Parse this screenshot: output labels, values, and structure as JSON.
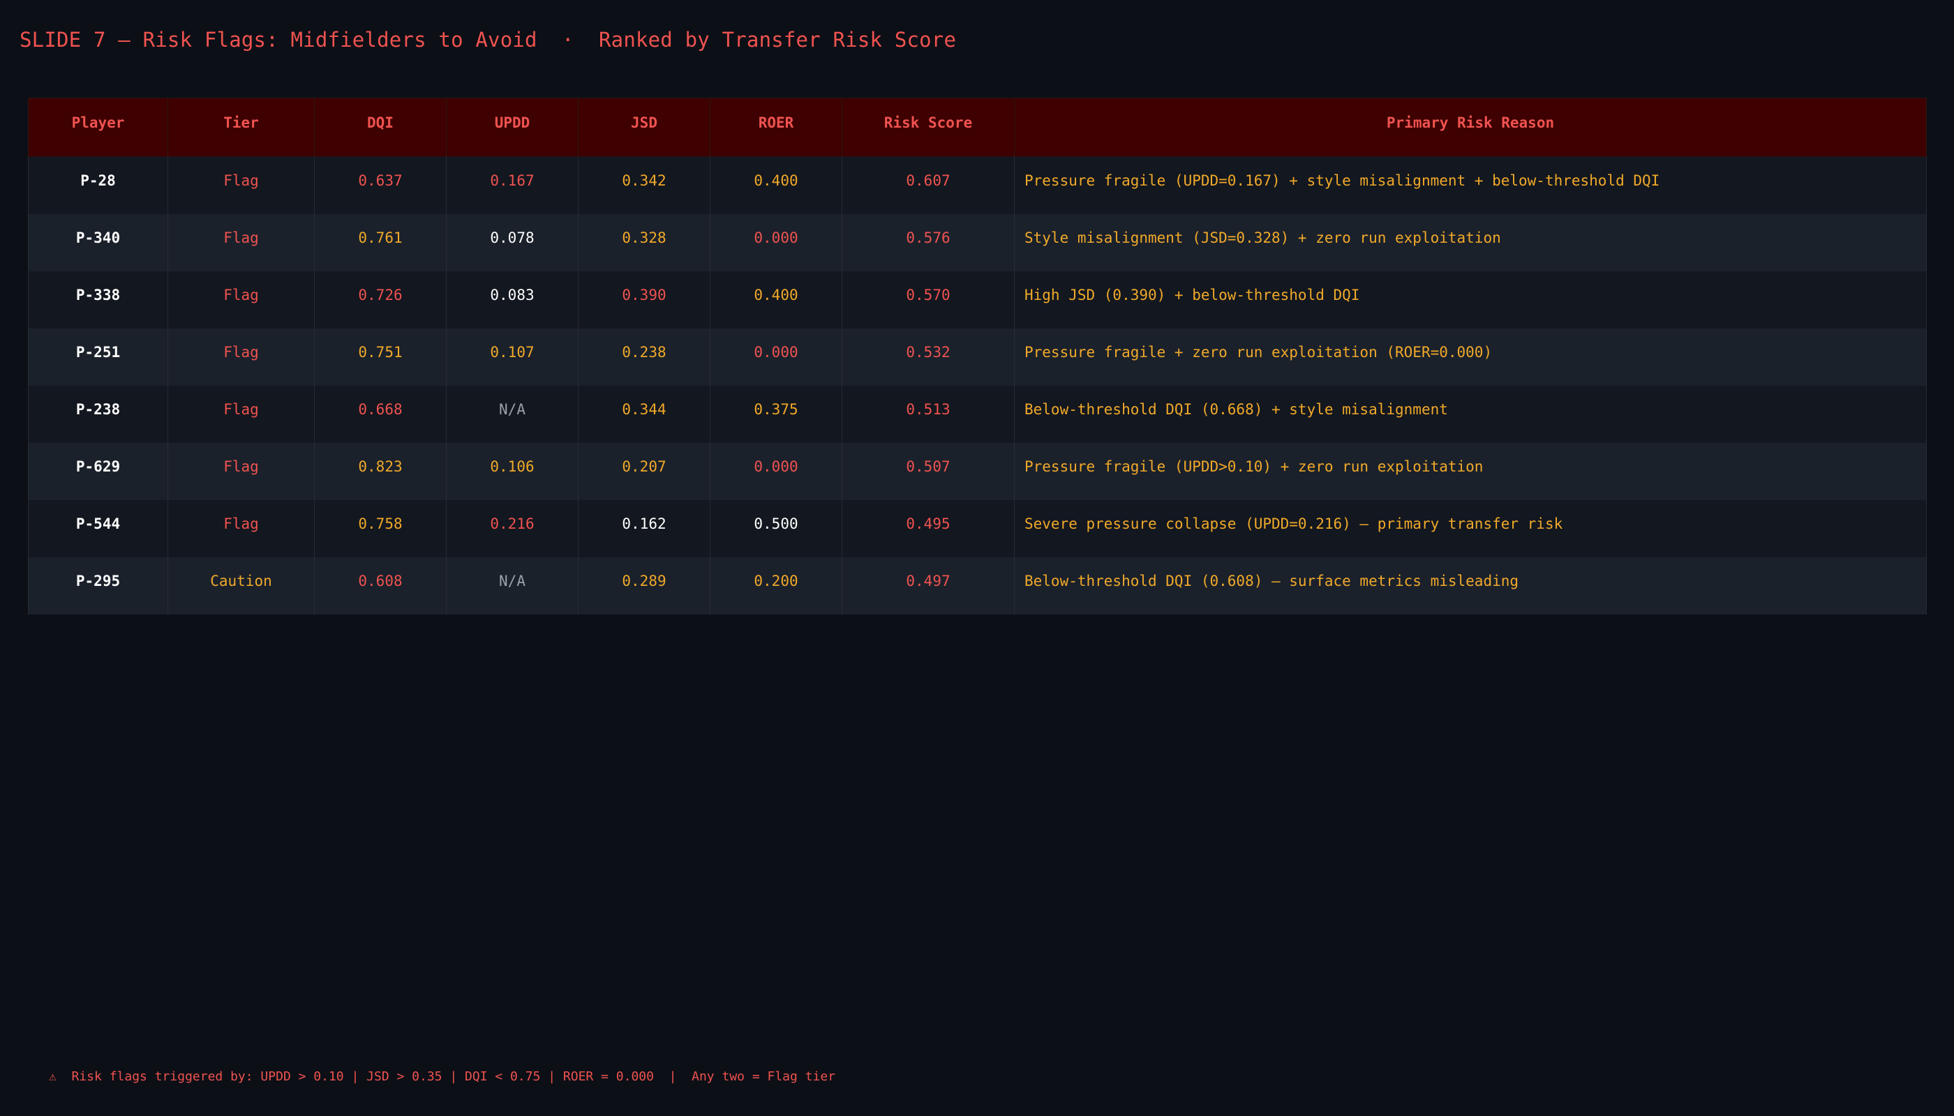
{
  "slide": {
    "title": "SLIDE 7 — Risk Flags: Midfielders to Avoid  ·  Ranked by Transfer Risk Score"
  },
  "table": {
    "headers": [
      "Player",
      "Tier",
      "DQI",
      "UPDD",
      "JSD",
      "ROER",
      "Risk Score",
      "Primary Risk Reason"
    ],
    "rows": [
      {
        "player": "P-28",
        "tier": {
          "text": "Flag",
          "color": "red"
        },
        "dqi": {
          "text": "0.637",
          "color": "red"
        },
        "updd": {
          "text": "0.167",
          "color": "red"
        },
        "jsd": {
          "text": "0.342",
          "color": "amber"
        },
        "roer": {
          "text": "0.400",
          "color": "amber"
        },
        "risk": {
          "text": "0.607",
          "color": "red"
        },
        "reason": "Pressure fragile (UPDD=0.167) + style misalignment + below-threshold DQI"
      },
      {
        "player": "P-340",
        "tier": {
          "text": "Flag",
          "color": "red"
        },
        "dqi": {
          "text": "0.761",
          "color": "amber"
        },
        "updd": {
          "text": "0.078",
          "color": "white"
        },
        "jsd": {
          "text": "0.328",
          "color": "amber"
        },
        "roer": {
          "text": "0.000",
          "color": "red"
        },
        "risk": {
          "text": "0.576",
          "color": "red"
        },
        "reason": "Style misalignment (JSD=0.328) + zero run exploitation"
      },
      {
        "player": "P-338",
        "tier": {
          "text": "Flag",
          "color": "red"
        },
        "dqi": {
          "text": "0.726",
          "color": "red"
        },
        "updd": {
          "text": "0.083",
          "color": "white"
        },
        "jsd": {
          "text": "0.390",
          "color": "red"
        },
        "roer": {
          "text": "0.400",
          "color": "amber"
        },
        "risk": {
          "text": "0.570",
          "color": "red"
        },
        "reason": "High JSD (0.390) + below-threshold DQI"
      },
      {
        "player": "P-251",
        "tier": {
          "text": "Flag",
          "color": "red"
        },
        "dqi": {
          "text": "0.751",
          "color": "amber"
        },
        "updd": {
          "text": "0.107",
          "color": "amber"
        },
        "jsd": {
          "text": "0.238",
          "color": "amber"
        },
        "roer": {
          "text": "0.000",
          "color": "red"
        },
        "risk": {
          "text": "0.532",
          "color": "red"
        },
        "reason": "Pressure fragile + zero run exploitation (ROER=0.000)"
      },
      {
        "player": "P-238",
        "tier": {
          "text": "Flag",
          "color": "red"
        },
        "dqi": {
          "text": "0.668",
          "color": "red"
        },
        "updd": {
          "text": "N/A",
          "color": "gray"
        },
        "jsd": {
          "text": "0.344",
          "color": "amber"
        },
        "roer": {
          "text": "0.375",
          "color": "amber"
        },
        "risk": {
          "text": "0.513",
          "color": "red"
        },
        "reason": "Below-threshold DQI (0.668) + style misalignment"
      },
      {
        "player": "P-629",
        "tier": {
          "text": "Flag",
          "color": "red"
        },
        "dqi": {
          "text": "0.823",
          "color": "amber"
        },
        "updd": {
          "text": "0.106",
          "color": "amber"
        },
        "jsd": {
          "text": "0.207",
          "color": "amber"
        },
        "roer": {
          "text": "0.000",
          "color": "red"
        },
        "risk": {
          "text": "0.507",
          "color": "red"
        },
        "reason": "Pressure fragile (UPDD>0.10) + zero run exploitation"
      },
      {
        "player": "P-544",
        "tier": {
          "text": "Flag",
          "color": "red"
        },
        "dqi": {
          "text": "0.758",
          "color": "amber"
        },
        "updd": {
          "text": "0.216",
          "color": "red"
        },
        "jsd": {
          "text": "0.162",
          "color": "white"
        },
        "roer": {
          "text": "0.500",
          "color": "white"
        },
        "risk": {
          "text": "0.495",
          "color": "red"
        },
        "reason": "Severe pressure collapse (UPDD=0.216) — primary transfer risk"
      },
      {
        "player": "P-295",
        "tier": {
          "text": "Caution",
          "color": "amber"
        },
        "dqi": {
          "text": "0.608",
          "color": "red"
        },
        "updd": {
          "text": "N/A",
          "color": "gray"
        },
        "jsd": {
          "text": "0.289",
          "color": "amber"
        },
        "roer": {
          "text": "0.200",
          "color": "amber"
        },
        "risk": {
          "text": "0.497",
          "color": "red"
        },
        "reason": "Below-threshold DQI (0.608) — surface metrics misleading"
      }
    ]
  },
  "footer": {
    "note": "⚠  Risk flags triggered by: UPDD > 0.10 | JSD > 0.35 | DQI < 0.75 | ROER = 0.000  |  Any two = Flag tier"
  },
  "colors": {
    "background": "#0c0f16",
    "header_bg": "#3e0000",
    "red": "#ef5350",
    "amber": "#f0a92a",
    "white": "#ffffff",
    "gray": "#9aa0a8"
  }
}
